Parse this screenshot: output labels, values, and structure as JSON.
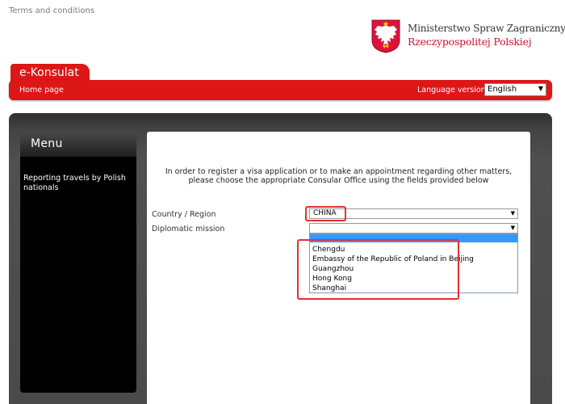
{
  "header": {
    "terms_link": "Terms and conditions",
    "ministry_line1": "Ministerstwo Spraw Zagranicznych",
    "ministry_line2": "Rzeczypospolitej Polskiej",
    "emblem_icon": "polish-eagle-emblem-icon"
  },
  "brand": {
    "title": "e-Konsulat"
  },
  "navbar": {
    "home_link": "Home page",
    "language_label": "Language version",
    "language_selected": "English"
  },
  "menu": {
    "title": "Menu",
    "items": [
      {
        "label": "Reporting travels by Polish nationals"
      }
    ]
  },
  "form": {
    "intro_line1": "In order to register a visa application or to make an appointment regarding other matters,",
    "intro_line2": "please choose the appropriate Consular Office using the fields provided below",
    "country_label": "Country / Region",
    "country_value": "CHINA",
    "mission_label": "Diplomatic mission",
    "mission_value": "",
    "mission_options": [
      "Chengdu",
      "Embassy of the Republic of Poland in Beijing",
      "Guangzhou",
      "Hong Kong",
      "Shanghai"
    ]
  },
  "colors": {
    "brand_red": "#dd1616",
    "dark_background": "#4a4a4a",
    "menu_background": "#000000",
    "selection_blue": "#3399ff",
    "annotation_red": "#e53030"
  }
}
